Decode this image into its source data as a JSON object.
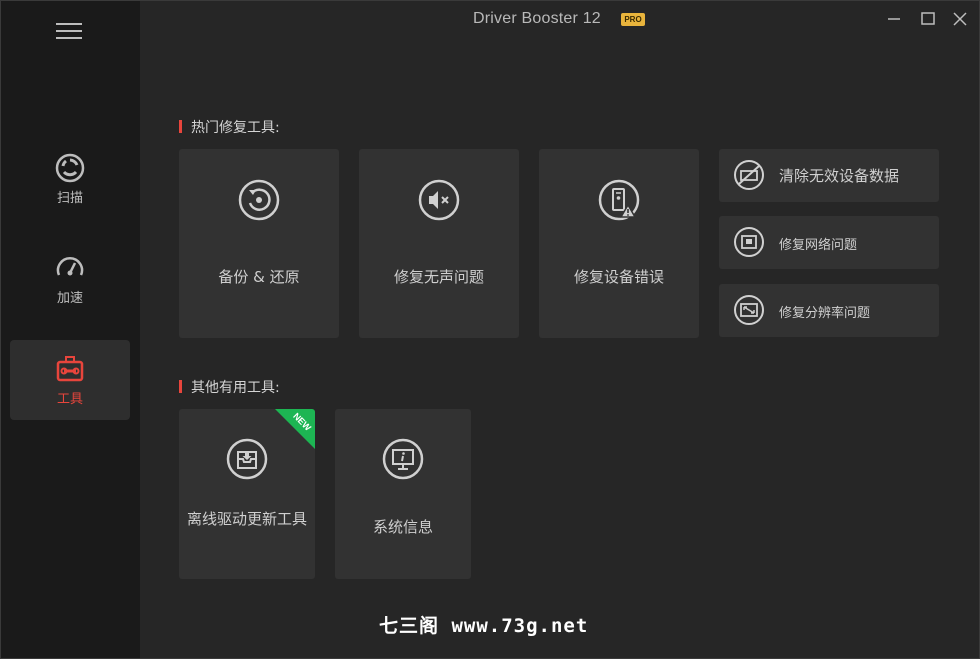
{
  "app": {
    "title": "Driver Booster 12",
    "badge": "PRO"
  },
  "colors": {
    "accent": "#e8453c",
    "badge": "#e9b43c",
    "new_ribbon": "#1db553"
  },
  "sidebar": {
    "items": [
      {
        "label": "扫描",
        "icon": "scan-icon",
        "active": false
      },
      {
        "label": "加速",
        "icon": "speedometer-icon",
        "active": false
      },
      {
        "label": "工具",
        "icon": "toolbox-icon",
        "active": true
      }
    ]
  },
  "sections": {
    "hot": {
      "title": "热门修复工具:",
      "tiles": [
        {
          "label": "备份 & 还原",
          "icon": "backup-restore-icon"
        },
        {
          "label": "修复无声问题",
          "icon": "speaker-mute-icon"
        },
        {
          "label": "修复设备错误",
          "icon": "device-warning-icon"
        }
      ],
      "side": [
        {
          "label": "清除无效设备数据",
          "icon": "device-clean-icon"
        },
        {
          "label": "修复网络问题",
          "icon": "network-port-icon"
        },
        {
          "label": "修复分辨率问题",
          "icon": "resolution-icon"
        }
      ]
    },
    "other": {
      "title": "其他有用工具:",
      "tiles": [
        {
          "label": "离线驱动更新工具",
          "icon": "offline-update-icon",
          "ribbon": "NEW"
        },
        {
          "label": "系统信息",
          "icon": "system-info-icon"
        }
      ]
    }
  },
  "watermark": "七三阁 www.73g.net"
}
